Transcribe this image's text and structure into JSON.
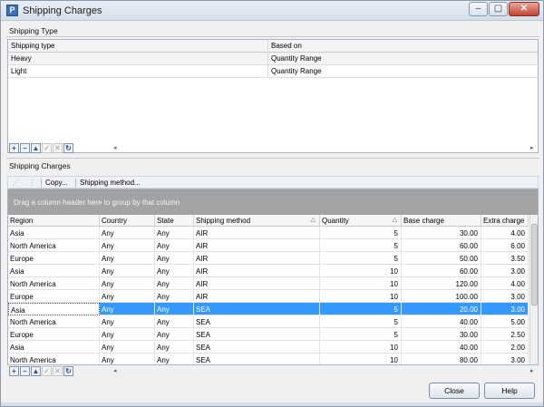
{
  "window": {
    "title": "Shipping Charges",
    "controls": {
      "min": "–",
      "max": "▢",
      "close": "✕"
    }
  },
  "shipping_type": {
    "section_label": "Shipping Type",
    "columns": [
      "Shipping type",
      "Based on"
    ],
    "rows": [
      {
        "type": "Heavy",
        "based_on": "Quantity Range"
      },
      {
        "type": "Light",
        "based_on": "Quantity Range"
      }
    ]
  },
  "shipping_charges": {
    "section_label": "Shipping Charges",
    "toolbar": {
      "copy": "Copy...",
      "method": "Shipping method..."
    },
    "group_hint": "Drag a column header here to group by that column",
    "columns": [
      "Region",
      "Country",
      "State",
      "Shipping method",
      "Quantity",
      "Base charge",
      "Extra charge"
    ],
    "rows": [
      [
        "Asia",
        "Any",
        "Any",
        "AIR",
        "5",
        "30.00",
        "4.00"
      ],
      [
        "North America",
        "Any",
        "Any",
        "AIR",
        "5",
        "60.00",
        "6.00"
      ],
      [
        "Europe",
        "Any",
        "Any",
        "AIR",
        "5",
        "50.00",
        "3.50"
      ],
      [
        "Asia",
        "Any",
        "Any",
        "AIR",
        "10",
        "60.00",
        "3.00"
      ],
      [
        "North America",
        "Any",
        "Any",
        "AIR",
        "10",
        "120.00",
        "4.00"
      ],
      [
        "Europe",
        "Any",
        "Any",
        "AIR",
        "10",
        "100.00",
        "3.00"
      ],
      [
        "Asia",
        "Any",
        "Any",
        "SEA",
        "5",
        "20.00",
        "3.00"
      ],
      [
        "North America",
        "Any",
        "Any",
        "SEA",
        "5",
        "40.00",
        "5.00"
      ],
      [
        "Europe",
        "Any",
        "Any",
        "SEA",
        "5",
        "30.00",
        "2.50"
      ],
      [
        "Asia",
        "Any",
        "Any",
        "SEA",
        "10",
        "40.00",
        "2.00"
      ],
      [
        "North America",
        "Any",
        "Any",
        "SEA",
        "10",
        "80.00",
        "3.00"
      ]
    ],
    "selected_row": 6
  },
  "nav_buttons": [
    "+",
    "–",
    "▲",
    "✓",
    "✕",
    "↻"
  ],
  "buttons": {
    "close": "Close",
    "help": "Help"
  },
  "colors": {
    "selection": "#3399ff",
    "group_panel": "#a3a3a3"
  }
}
